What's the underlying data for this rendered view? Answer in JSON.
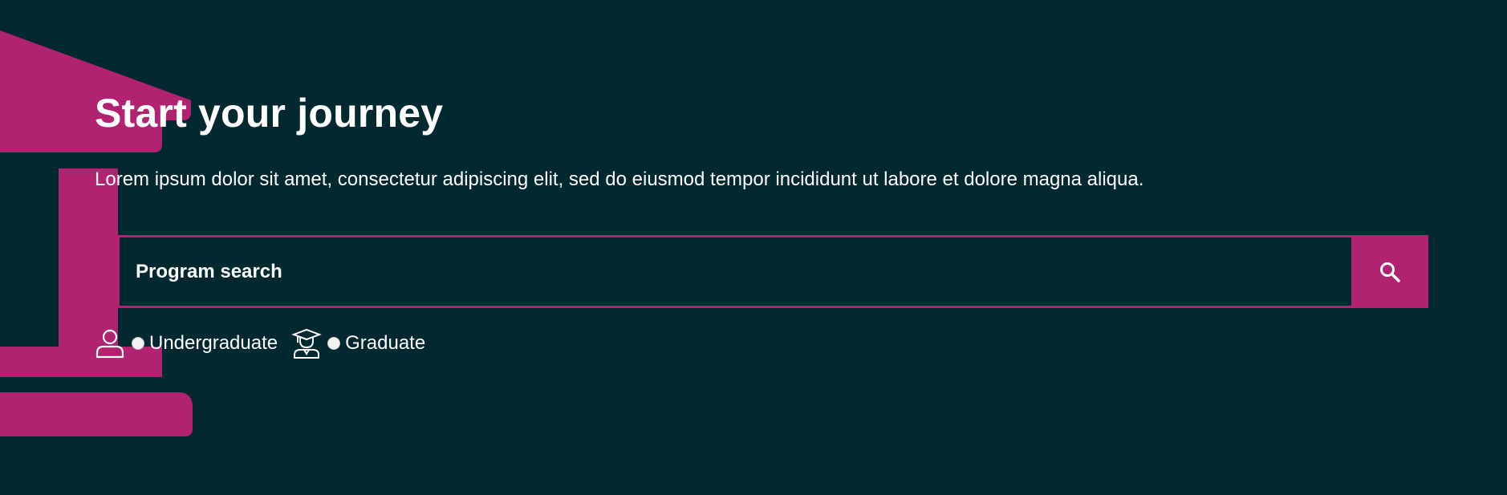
{
  "theme": {
    "background": "#022830",
    "accent": "#b12370",
    "text": "#ffffff"
  },
  "hero": {
    "headline": "Start your journey",
    "intro": "Lorem ipsum dolor sit amet, consectetur adipiscing elit, sed do eiusmod tempor incididunt ut labore et dolore magna aliqua."
  },
  "search": {
    "placeholder": "Program search",
    "value": "",
    "button_icon": "search-icon"
  },
  "program_levels": [
    {
      "label": "Undergraduate",
      "icon": "person-icon",
      "selected": false
    },
    {
      "label": "Graduate",
      "icon": "graduate-icon",
      "selected": false
    }
  ]
}
